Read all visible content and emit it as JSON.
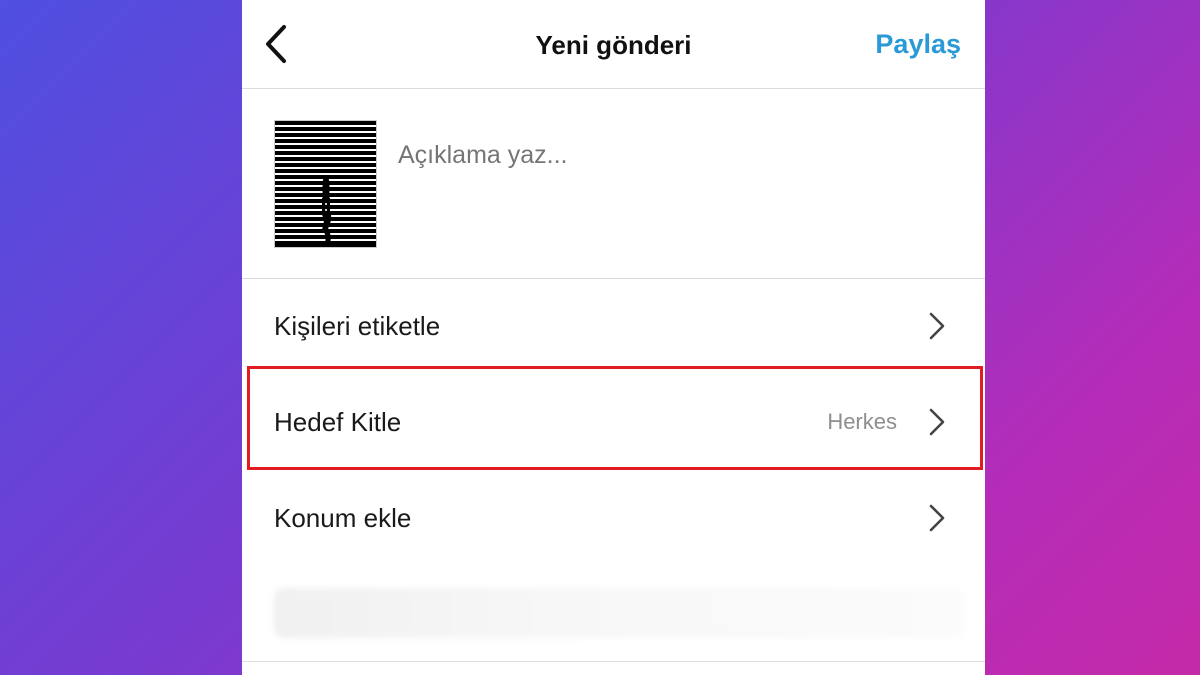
{
  "header": {
    "title": "Yeni gönderi",
    "share_label": "Paylaş",
    "share_color": "#2a9ad6"
  },
  "compose": {
    "caption_placeholder": "Açıklama yaz..."
  },
  "options": [
    {
      "label": "Kişileri etiketle",
      "value": ""
    },
    {
      "label": "Hedef Kitle",
      "value": "Herkes"
    },
    {
      "label": "Konum ekle",
      "value": ""
    }
  ],
  "icons": {
    "back": "chevron-left-icon",
    "row_arrow": "chevron-right-icon"
  },
  "colors": {
    "highlight": "#e31c23",
    "divider": "#dbdbdb"
  }
}
